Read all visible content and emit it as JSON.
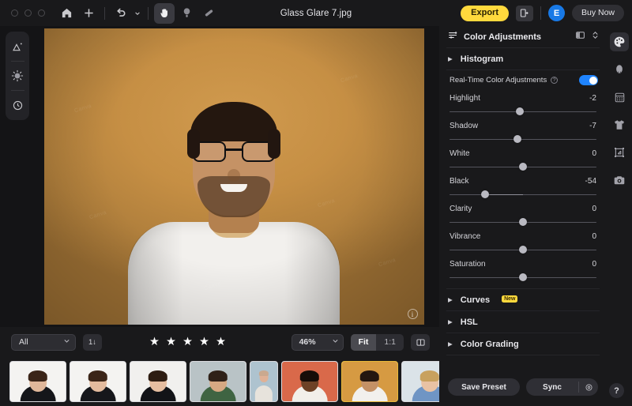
{
  "window": {
    "title": "Glass Glare 7.jpg"
  },
  "toolbar": {
    "home_icon": "home-icon",
    "add_icon": "plus-icon",
    "undo_icon": "undo-arrow-icon",
    "undo_caret": "chevron-down-icon",
    "hand_icon": "hand-tool-icon",
    "retouch_icon": "retouch-brush-icon",
    "heal_icon": "healing-patch-icon",
    "export_label": "Export",
    "exit_icon": "exit-door-icon",
    "avatar_initial": "E",
    "buy_label": "Buy Now",
    "export_bg": "#ffd93d",
    "avatar_bg": "#1879e6"
  },
  "left_rail": {
    "items": [
      {
        "name": "landscape-tool-icon"
      },
      {
        "name": "light-adjust-icon"
      },
      {
        "name": "history-clock-icon"
      }
    ]
  },
  "canvas": {
    "info_icon": "info-icon",
    "watermarks": [
      "Canva",
      "Canva",
      "Canva",
      "Canva",
      "Canva",
      "Canva"
    ]
  },
  "bottom_bar": {
    "filter_value": "All",
    "filter_caret": "chevron-down-icon",
    "sort_label": "1↓",
    "stars": [
      "★",
      "★",
      "★",
      "★",
      "★"
    ],
    "star_count": 5,
    "zoom_value": "46%",
    "zoom_caret": "chevron-down-icon",
    "fit_label": "Fit",
    "one_to_one_label": "1:1",
    "active_fit": "Fit",
    "panel_toggle_icon": "split-panel-icon"
  },
  "filmstrip": {
    "selected_index": 6,
    "items": [
      {
        "name": "thumbnail-1",
        "bg": "#f4f3f1",
        "skin": "#e0b79a",
        "hair": "#3a2418",
        "cloth": "#15161a",
        "narrow": false
      },
      {
        "name": "thumbnail-2",
        "bg": "#f4f3f1",
        "skin": "#e3bb9e",
        "hair": "#3b2518",
        "cloth": "#16171b",
        "narrow": false
      },
      {
        "name": "thumbnail-3",
        "bg": "#f1f0ee",
        "skin": "#e5bda0",
        "hair": "#2d1c12",
        "cloth": "#121317",
        "narrow": false
      },
      {
        "name": "thumbnail-4",
        "bg": "#b9c3c6",
        "skin": "#d6a882",
        "hair": "#2f2118",
        "cloth": "#3f6442",
        "narrow": false
      },
      {
        "name": "thumbnail-5",
        "bg": "#aec3cf",
        "skin": "#dfb196",
        "hair": "#caa98f",
        "cloth": "#e7e3dc",
        "narrow": true
      },
      {
        "name": "thumbnail-6",
        "bg": "#d9694a",
        "skin": "#6d4226",
        "hair": "#160d08",
        "cloth": "#f2efe9",
        "narrow": false
      },
      {
        "name": "thumbnail-7",
        "bg": "#d69a42",
        "skin": "#c49166",
        "hair": "#241710",
        "cloth": "#f2f0ed",
        "narrow": false
      },
      {
        "name": "thumbnail-8",
        "bg": "#dbe3e8",
        "skin": "#e8c2a4",
        "hair": "#c8a15e",
        "cloth": "#6f95c4",
        "narrow": false
      },
      {
        "name": "thumbnail-9",
        "bg": "#cfd9e0",
        "skin": "#e5bfa0",
        "hair": "#4a331f",
        "cloth": "#3f74b8",
        "narrow": true
      }
    ]
  },
  "right_panel": {
    "header": {
      "icon": "sliders-icon",
      "title": "Color Adjustments",
      "layout_icon": "panel-layout-icon",
      "stepper_icon": "chevron-up-down-icon"
    },
    "histogram": {
      "caret": "caret-right-icon",
      "label": "Histogram"
    },
    "realtime": {
      "label": "Real-Time Color Adjustments",
      "help_icon": "question-mark-icon",
      "enabled": true,
      "toggle_color": "#1f84ff"
    },
    "sliders": [
      {
        "name": "Highlight",
        "value": "-2",
        "pos": 48,
        "fill_from": null
      },
      {
        "name": "Shadow",
        "value": "-7",
        "pos": 46.5,
        "fill_from": null
      },
      {
        "name": "White",
        "value": "0",
        "pos": 50,
        "fill_from": null
      },
      {
        "name": "Black",
        "value": "-54",
        "pos": 24,
        "fill_from": 50
      },
      {
        "name": "Clarity",
        "value": "0",
        "pos": 50,
        "fill_from": null
      },
      {
        "name": "Vibrance",
        "value": "0",
        "pos": 50,
        "fill_from": null
      },
      {
        "name": "Saturation",
        "value": "0",
        "pos": 50,
        "fill_from": null
      }
    ],
    "sections": [
      {
        "label": "Curves",
        "caret": "caret-right-icon",
        "badge": "New"
      },
      {
        "label": "HSL",
        "caret": "caret-right-icon",
        "badge": null
      },
      {
        "label": "Color Grading",
        "caret": "caret-right-icon",
        "badge": null
      }
    ],
    "actions": {
      "save_preset_label": "Save Preset",
      "sync_label": "Sync",
      "sync_settings_icon": "gear-icon"
    }
  },
  "right_rail": {
    "items": [
      {
        "name": "palette-icon",
        "active": true
      },
      {
        "name": "portrait-face-icon",
        "active": false
      },
      {
        "name": "presets-grid-icon",
        "active": false
      },
      {
        "name": "tshirt-icon",
        "active": false
      },
      {
        "name": "crop-icon",
        "active": false
      },
      {
        "name": "camera-icon",
        "active": false
      }
    ],
    "help_label": "?"
  }
}
